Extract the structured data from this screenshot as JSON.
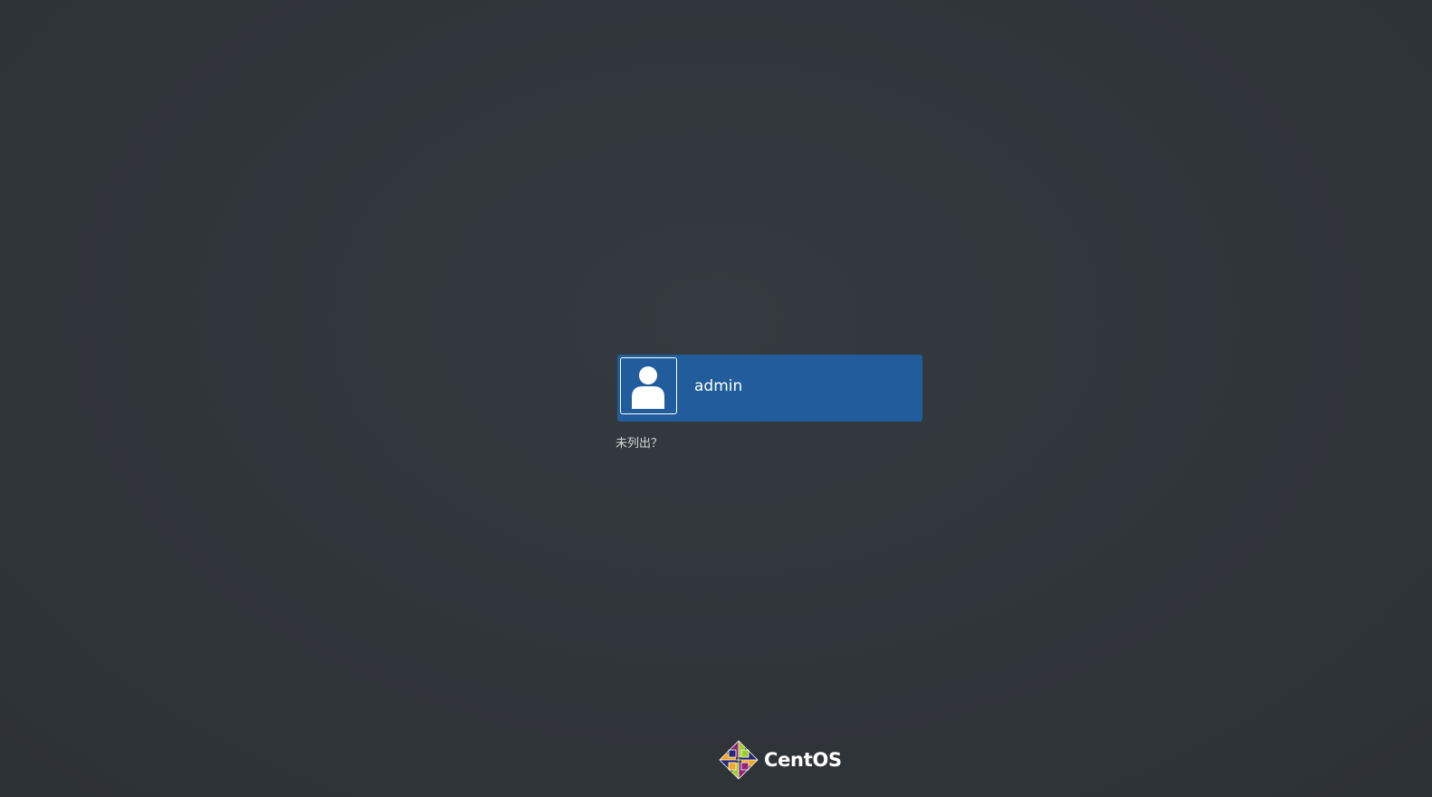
{
  "login": {
    "users": [
      {
        "name": "admin",
        "avatar_icon": "user-silhouette-icon"
      }
    ],
    "not_listed_label": "未列出？"
  },
  "branding": {
    "logo_icon": "centos-logo-icon",
    "logo_text": "CentOS"
  },
  "colors": {
    "background": "#30353a",
    "selected_row": "#215d9c",
    "text_primary": "#ffffff",
    "text_secondary": "#d6d8d9"
  }
}
